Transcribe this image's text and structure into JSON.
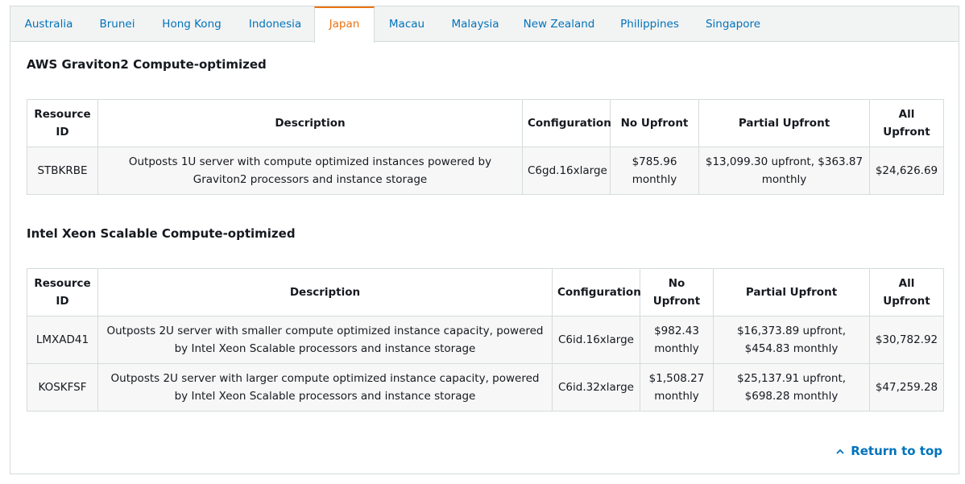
{
  "tabs": [
    {
      "label": "Australia"
    },
    {
      "label": "Brunei"
    },
    {
      "label": "Hong Kong"
    },
    {
      "label": "Indonesia"
    },
    {
      "label": "Japan",
      "active": true
    },
    {
      "label": "Macau"
    },
    {
      "label": "Malaysia"
    },
    {
      "label": "New Zealand"
    },
    {
      "label": "Philippines"
    },
    {
      "label": "Singapore"
    }
  ],
  "sections": [
    {
      "title": "AWS Graviton2 Compute-optimized",
      "headers": [
        "Resource ID",
        "Description",
        "Configuration",
        "No Upfront",
        "Partial Upfront",
        "All Upfront"
      ],
      "rows": [
        [
          "STBKRBE",
          "Outposts 1U server with compute optimized instances powered by Graviton2 processors and instance storage",
          "C6gd.16xlarge",
          "$785.96 monthly",
          "$13,099.30 upfront, $363.87 monthly",
          "$24,626.69"
        ]
      ]
    },
    {
      "title": "Intel Xeon Scalable Compute-optimized",
      "headers": [
        "Resource ID",
        "Description",
        "Configuration",
        "No Upfront",
        "Partial Upfront",
        "All Upfront"
      ],
      "rows": [
        [
          "LMXAD41",
          "Outposts 2U server with smaller compute optimized instance capacity, powered by Intel Xeon Scalable processors and instance storage",
          "C6id.16xlarge",
          "$982.43 monthly",
          "$16,373.89 upfront, $454.83 monthly",
          "$30,782.92"
        ],
        [
          "KOSKFSF",
          "Outposts 2U server with larger compute optimized instance capacity, powered by Intel Xeon Scalable processors and instance storage",
          "C6id.32xlarge",
          "$1,508.27 monthly",
          "$25,137.91 upfront, $698.28 monthly",
          "$47,259.28"
        ]
      ]
    }
  ],
  "footer": {
    "return_label": "Return to top",
    "return_icon": "chevron-up-icon"
  },
  "colors": {
    "link": "#0073bb",
    "active_tab": "#ec7211",
    "border": "#d5dbdb",
    "tabbar_bg": "#f2f3f3",
    "row_bg": "#f7f7f7"
  }
}
